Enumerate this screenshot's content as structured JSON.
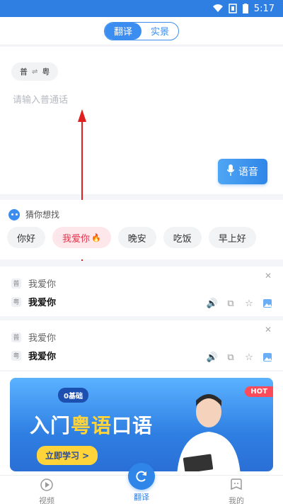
{
  "status": {
    "time": "5:17"
  },
  "header": {
    "tabs": [
      {
        "label": "翻译",
        "active": true
      },
      {
        "label": "实景",
        "active": false
      }
    ]
  },
  "input": {
    "lang_from": "普",
    "lang_to": "粤",
    "placeholder": "请输入普通话",
    "voice_label": "语音"
  },
  "suggestions": {
    "title": "猜你想找",
    "chips": [
      {
        "label": "你好"
      },
      {
        "label": "我爱你",
        "hot": true
      },
      {
        "label": "晚安"
      },
      {
        "label": "吃饭"
      },
      {
        "label": "早上好"
      }
    ]
  },
  "history": [
    {
      "src_tag": "普",
      "src_text": "我爱你",
      "dst_tag": "粤",
      "dst_text": "我爱你"
    },
    {
      "src_tag": "普",
      "src_text": "我爱你",
      "dst_tag": "粤",
      "dst_text": "我爱你"
    }
  ],
  "banner": {
    "badge": "0基础",
    "headline_a": "入门",
    "headline_b": "粤语",
    "headline_c": "口语",
    "cta": "立即学习 >",
    "hot": "HOT"
  },
  "nav": {
    "items": [
      {
        "label": "视频"
      },
      {
        "label": "翻译"
      },
      {
        "label": "我的"
      }
    ]
  },
  "colors": {
    "accent": "#2f86e8",
    "hot": "#e8324b",
    "highlight": "#ffd43b"
  }
}
